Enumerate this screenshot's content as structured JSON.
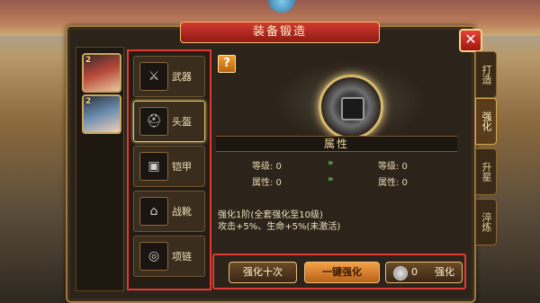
{
  "window": {
    "title": "装备锻造",
    "close": "✕"
  },
  "side_tabs": [
    {
      "label": "打造",
      "active": false
    },
    {
      "label": "强化",
      "active": true
    },
    {
      "label": "升星",
      "active": false
    },
    {
      "label": "淬炼",
      "active": false
    }
  ],
  "characters": [
    {
      "level": "2"
    },
    {
      "level": "2"
    }
  ],
  "equipment": [
    {
      "label": "武器",
      "active": false,
      "icon": "sword-icon"
    },
    {
      "label": "头盔",
      "active": true,
      "icon": "helmet-icon"
    },
    {
      "label": "铠甲",
      "active": false,
      "icon": "armor-icon"
    },
    {
      "label": "战靴",
      "active": false,
      "icon": "boots-icon"
    },
    {
      "label": "项链",
      "active": false,
      "icon": "necklace-icon"
    }
  ],
  "help_label": "?",
  "attributes": {
    "header": "属性",
    "left": {
      "level": "等级: 0",
      "attr": "属性: 0"
    },
    "right": {
      "level": "等级: 0",
      "attr": "属性: 0"
    }
  },
  "description": {
    "line1": "强化1阶(全套强化至10级)",
    "line2": "攻击+5%、生命+5%(未激活)"
  },
  "buttons": {
    "ten": "强化十次",
    "auto": "一键强化",
    "cost": "0",
    "enhance": "强化"
  }
}
